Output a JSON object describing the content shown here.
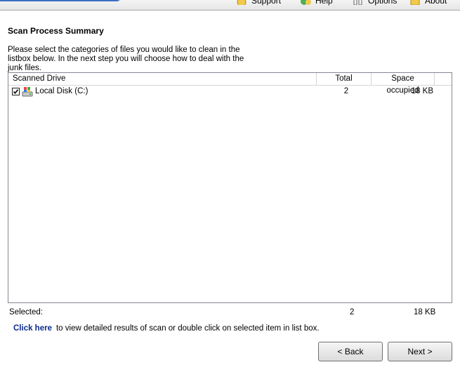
{
  "toolbar": {
    "items": [
      {
        "label": "Support",
        "icon": "support-icon"
      },
      {
        "label": "Help",
        "icon": "help-icon"
      },
      {
        "label": "Options",
        "icon": "options-icon"
      },
      {
        "label": "About",
        "icon": "about-icon"
      }
    ]
  },
  "summary": {
    "title": "Scan Process Summary",
    "description": "Please select the categories of files you would like to clean in the listbox below. In the next step you will choose how to deal with the junk files."
  },
  "list": {
    "columns": [
      "Scanned Drive",
      "Total",
      "Space occupied"
    ],
    "rows": [
      {
        "checked": true,
        "icon": "drive-icon",
        "name": "Local Disk (C:)",
        "total": "2",
        "space": "18 KB"
      }
    ]
  },
  "footer": {
    "selected_label": "Selected:",
    "selected_total": "2",
    "selected_space": "18 KB",
    "link_text": "Click here",
    "hint_text": "to view detailed results of scan or double click on selected item in list box."
  },
  "buttons": {
    "back": "< Back",
    "next": "Next >"
  },
  "colors": {
    "link": "#0a2a8c",
    "accent": "#3b6fc4"
  }
}
